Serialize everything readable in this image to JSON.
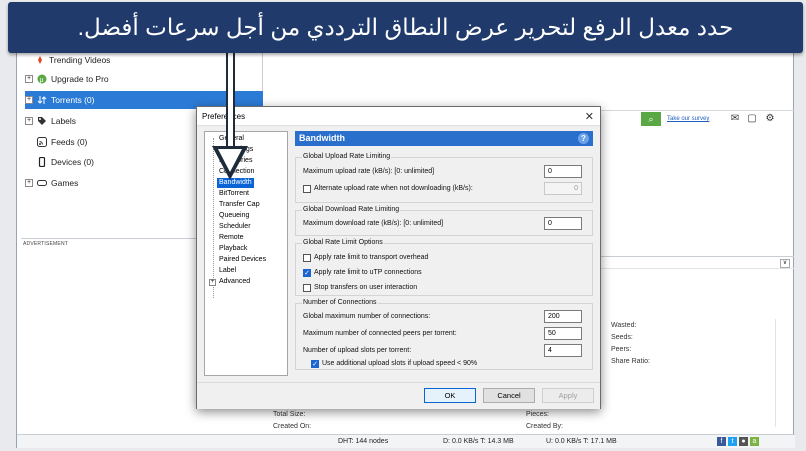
{
  "banner": {
    "text": "حدد معدل الرفع لتحرير عرض النطاق الترددي من أجل سرعات أفضل."
  },
  "sidebar": {
    "items": [
      {
        "label": "Trending Videos",
        "icon": "fire-icon"
      },
      {
        "label": "Upgrade to Pro",
        "icon": "utorrent-icon"
      },
      {
        "label": "Torrents (0)",
        "icon": "torrent-arrows-icon"
      },
      {
        "label": "Labels",
        "icon": "tag-icon"
      },
      {
        "label": "Feeds (0)",
        "icon": "rss-icon"
      },
      {
        "label": "Devices (0)",
        "icon": "phone-icon"
      },
      {
        "label": "Games",
        "icon": "gamepad-icon"
      }
    ],
    "advert_label": "ADVERTISEMENT"
  },
  "toolbar": {
    "survey_link": "Take our survey"
  },
  "details": {
    "wasted": "Wasted:",
    "seeds": "Seeds:",
    "peers": "Peers:",
    "share_ratio": "Share Ratio:",
    "total_size": "Total Size:",
    "created_on": "Created On:",
    "pieces": "Pieces:",
    "created_by": "Created By:"
  },
  "status": {
    "dht": "DHT: 144 nodes",
    "down": "D: 0.0 KB/s T: 14.3 MB",
    "up": "U: 0.0 KB/s T: 17.1 MB"
  },
  "dialog": {
    "title": "Preferences",
    "tree": [
      "General",
      "UI Settings",
      "Directories",
      "Connection",
      "Bandwidth",
      "BitTorrent",
      "Transfer Cap",
      "Queueing",
      "Scheduler",
      "Remote",
      "Playback",
      "Paired Devices",
      "Label",
      "Advanced"
    ],
    "selected": "Bandwidth",
    "section_title": "Bandwidth",
    "upload": {
      "title": "Global Upload Rate Limiting",
      "max_label": "Maximum upload rate (kB/s): [0: unlimited]",
      "max_value": "0",
      "alt_label": "Alternate upload rate when not downloading (kB/s):",
      "alt_value": "0"
    },
    "download": {
      "title": "Global Download Rate Limiting",
      "max_label": "Maximum download rate (kB/s): [0: unlimited]",
      "max_value": "0"
    },
    "options": {
      "title": "Global Rate Limit Options",
      "items": [
        {
          "label": "Apply rate limit to transport overhead",
          "checked": false
        },
        {
          "label": "Apply rate limit to uTP connections",
          "checked": true
        },
        {
          "label": "Stop transfers on user interaction",
          "checked": false
        }
      ]
    },
    "connections": {
      "title": "Number of Connections",
      "global_label": "Global maximum number of connections:",
      "global_value": "200",
      "peers_label": "Maximum number of connected peers per torrent:",
      "peers_value": "50",
      "slots_label": "Number of upload slots per torrent:",
      "slots_value": "4",
      "extra_label": "Use additional upload slots if upload speed < 90%",
      "extra_checked": true
    },
    "buttons": {
      "ok": "OK",
      "cancel": "Cancel",
      "apply": "Apply"
    }
  },
  "colors": {
    "banner": "#1f3a6b",
    "selection": "#2b7bd6",
    "header": "#2b6fcc",
    "search_btn": "#5aa843"
  }
}
